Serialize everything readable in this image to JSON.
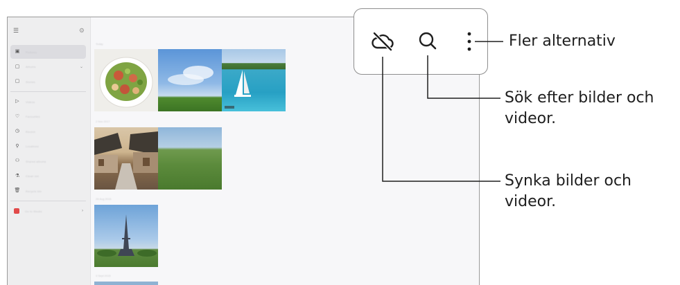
{
  "toolbar": {
    "sync_icon": "cloud-off-icon",
    "search_icon": "search-icon",
    "more_icon": "more-vertical-icon"
  },
  "callouts": {
    "more_options": "Fler alternativ",
    "search_line1": "Sök efter bilder och",
    "search_line2": "videor.",
    "sync_line1": "Synka bilder och",
    "sync_line2": "videor."
  },
  "sidebar": {
    "menu_icon": "menu-icon",
    "settings_icon": "gear-icon",
    "items": [
      {
        "icon": "photo-icon",
        "label": "Pictures"
      },
      {
        "icon": "album-icon",
        "label": "Albums"
      },
      {
        "icon": "stories-icon",
        "label": "Stories"
      },
      {
        "icon": "video-icon",
        "label": "Videos"
      },
      {
        "icon": "heart-icon",
        "label": "Favourites"
      },
      {
        "icon": "clock-icon",
        "label": "Recent"
      },
      {
        "icon": "location-icon",
        "label": "Locations"
      },
      {
        "icon": "shared-icon",
        "label": "Shared albums"
      },
      {
        "icon": "clean-icon",
        "label": "Clean out"
      },
      {
        "icon": "trash-icon",
        "label": "Recycle bin"
      },
      {
        "icon": "studio-icon",
        "label": "Go to Studio"
      }
    ]
  },
  "gallery": {
    "dates": [
      "Today",
      "2 Nov 2017",
      "28 Aug 2016",
      "3 Sept 2016"
    ]
  },
  "colors": {
    "accent_red": "#e14a4a",
    "callout_border": "#8e8e8e"
  }
}
